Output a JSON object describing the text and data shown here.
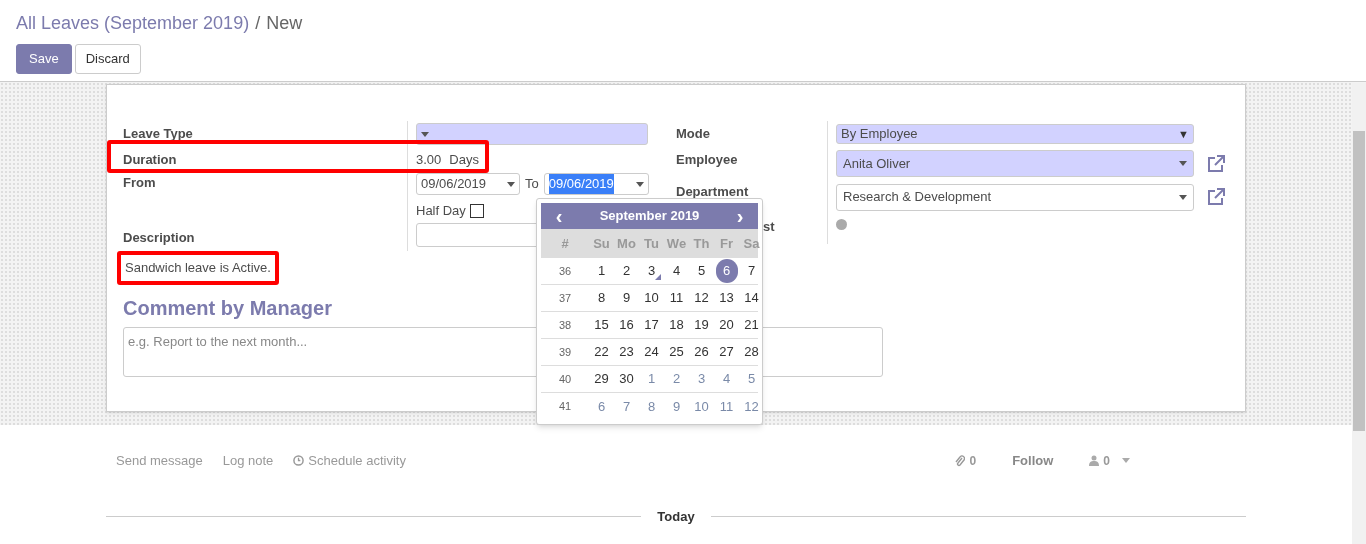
{
  "breadcrumb": {
    "parent": "All Leaves (September 2019)",
    "separator": "/",
    "current": "New"
  },
  "buttons": [
    {
      "label": "Save",
      "kind": "primary"
    },
    {
      "label": "Discard",
      "kind": "secondary"
    }
  ],
  "form": {
    "leave_type": {
      "label": "Leave Type"
    },
    "duration": {
      "label": "Duration",
      "value": "3.00",
      "unit": "Days",
      "highlighted": true
    },
    "from": {
      "label": "From",
      "start": "09/06/2019",
      "to_label": "To",
      "end": "09/06/2019",
      "end_selected": true
    },
    "half_day": {
      "label": "Half Day",
      "checked": false
    },
    "description": {
      "label": "Description",
      "note": "Sandwich leave is Active.",
      "highlighted": true
    },
    "mode": {
      "label": "Mode",
      "value": "By Employee",
      "arrow": "▼"
    },
    "employee": {
      "label": "Employee",
      "value": "Anita Oliver"
    },
    "department": {
      "label": "Department",
      "value": "Research & Development"
    },
    "hidden_label": {
      "label": "st"
    },
    "comment": {
      "title": "Comment by Manager",
      "placeholder": "e.g. Report to the next month..."
    }
  },
  "calendar": {
    "title": "September 2019",
    "prev": "‹",
    "next": "›",
    "headers": [
      "#",
      "Su",
      "Mo",
      "Tu",
      "We",
      "Th",
      "Fr",
      "Sa"
    ],
    "weeks": [
      {
        "week": "36",
        "days": [
          {
            "d": "1",
            "other": false,
            "selected": false,
            "today": false
          },
          {
            "d": "2",
            "other": false,
            "selected": false,
            "today": false
          },
          {
            "d": "3",
            "other": false,
            "selected": false,
            "today": true
          },
          {
            "d": "4",
            "other": false,
            "selected": false,
            "today": false
          },
          {
            "d": "5",
            "other": false,
            "selected": false,
            "today": false
          },
          {
            "d": "6",
            "other": false,
            "selected": true,
            "today": false
          },
          {
            "d": "7",
            "other": false,
            "selected": false,
            "today": false
          }
        ]
      },
      {
        "week": "37",
        "days": [
          {
            "d": "8",
            "other": false,
            "selected": false,
            "today": false
          },
          {
            "d": "9",
            "other": false,
            "selected": false,
            "today": false
          },
          {
            "d": "10",
            "other": false,
            "selected": false,
            "today": false
          },
          {
            "d": "11",
            "other": false,
            "selected": false,
            "today": false
          },
          {
            "d": "12",
            "other": false,
            "selected": false,
            "today": false
          },
          {
            "d": "13",
            "other": false,
            "selected": false,
            "today": false
          },
          {
            "d": "14",
            "other": false,
            "selected": false,
            "today": false
          }
        ]
      },
      {
        "week": "38",
        "days": [
          {
            "d": "15",
            "other": false,
            "selected": false,
            "today": false
          },
          {
            "d": "16",
            "other": false,
            "selected": false,
            "today": false
          },
          {
            "d": "17",
            "other": false,
            "selected": false,
            "today": false
          },
          {
            "d": "18",
            "other": false,
            "selected": false,
            "today": false
          },
          {
            "d": "19",
            "other": false,
            "selected": false,
            "today": false
          },
          {
            "d": "20",
            "other": false,
            "selected": false,
            "today": false
          },
          {
            "d": "21",
            "other": false,
            "selected": false,
            "today": false
          }
        ]
      },
      {
        "week": "39",
        "days": [
          {
            "d": "22",
            "other": false,
            "selected": false,
            "today": false
          },
          {
            "d": "23",
            "other": false,
            "selected": false,
            "today": false
          },
          {
            "d": "24",
            "other": false,
            "selected": false,
            "today": false
          },
          {
            "d": "25",
            "other": false,
            "selected": false,
            "today": false
          },
          {
            "d": "26",
            "other": false,
            "selected": false,
            "today": false
          },
          {
            "d": "27",
            "other": false,
            "selected": false,
            "today": false
          },
          {
            "d": "28",
            "other": false,
            "selected": false,
            "today": false
          }
        ]
      },
      {
        "week": "40",
        "days": [
          {
            "d": "29",
            "other": false,
            "selected": false,
            "today": false
          },
          {
            "d": "30",
            "other": false,
            "selected": false,
            "today": false
          },
          {
            "d": "1",
            "other": true,
            "selected": false,
            "today": false
          },
          {
            "d": "2",
            "other": true,
            "selected": false,
            "today": false
          },
          {
            "d": "3",
            "other": true,
            "selected": false,
            "today": false
          },
          {
            "d": "4",
            "other": true,
            "selected": false,
            "today": false
          },
          {
            "d": "5",
            "other": true,
            "selected": false,
            "today": false
          }
        ]
      },
      {
        "week": "41",
        "days": [
          {
            "d": "6",
            "other": true,
            "selected": false,
            "today": false
          },
          {
            "d": "7",
            "other": true,
            "selected": false,
            "today": false
          },
          {
            "d": "8",
            "other": true,
            "selected": false,
            "today": false
          },
          {
            "d": "9",
            "other": true,
            "selected": false,
            "today": false
          },
          {
            "d": "10",
            "other": true,
            "selected": false,
            "today": false
          },
          {
            "d": "11",
            "other": true,
            "selected": false,
            "today": false
          },
          {
            "d": "12",
            "other": true,
            "selected": false,
            "today": false
          }
        ]
      }
    ]
  },
  "chatter": {
    "actions": [
      "Send message",
      "Log note",
      "Schedule activity"
    ],
    "attachments": "0",
    "follow": "Follow",
    "followers": "0",
    "divider": "Today"
  }
}
